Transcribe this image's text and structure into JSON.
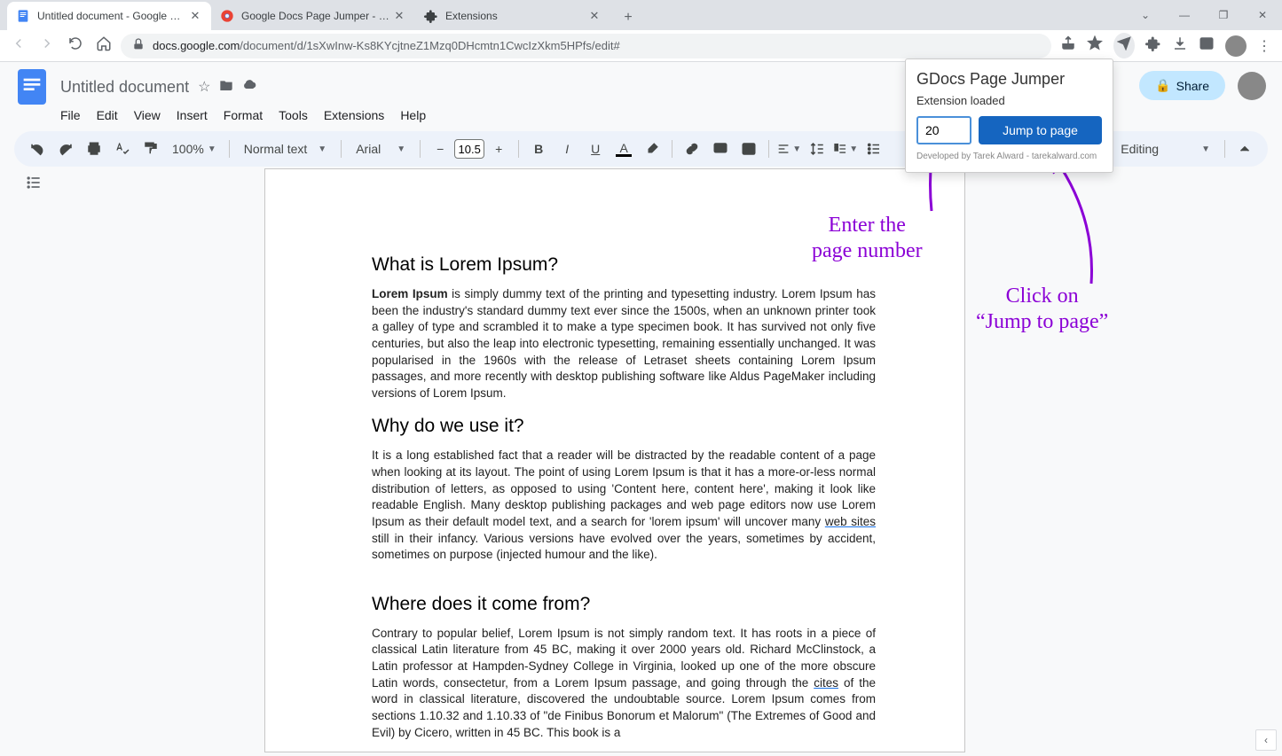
{
  "browser": {
    "tabs": [
      {
        "title": "Untitled document - Google Docs",
        "favicon": "docs"
      },
      {
        "title": "Google Docs Page Jumper - Chrome",
        "favicon": "chrome"
      },
      {
        "title": "Extensions",
        "favicon": "puzzle"
      }
    ],
    "url_domain": "docs.google.com",
    "url_path": "/document/d/1sXwInw-Ks8KYcjtneZ1Mzq0DHcmtn1CwcIzXkm5HPfs/edit#"
  },
  "docs": {
    "title": "Untitled document",
    "menu": [
      "File",
      "Edit",
      "View",
      "Insert",
      "Format",
      "Tools",
      "Extensions",
      "Help"
    ],
    "share": "Share",
    "zoom": "100%",
    "style": "Normal text",
    "font": "Arial",
    "font_size": "10.5",
    "mode": "Editing"
  },
  "doc_content": {
    "h1": "What is Lorem Ipsum?",
    "p1_lead": "Lorem Ipsum",
    "p1": " is simply dummy text of the printing and typesetting industry. Lorem Ipsum has been the industry's standard dummy text ever since the 1500s, when an unknown printer took a galley of type and scrambled it to make a type specimen book. It has survived not only five centuries, but also the leap into electronic typesetting, remaining essentially unchanged. It was popularised in the 1960s with the release of Letraset sheets containing Lorem Ipsum passages, and more recently with desktop publishing software like Aldus PageMaker including versions of Lorem Ipsum.",
    "h2": "Why do we use it?",
    "p2a": "It is a long established fact that a reader will be distracted by the readable content of a page when looking at its layout. The point of using Lorem Ipsum is that it has a more-or-less normal distribution of letters, as opposed to using 'Content here, content here', making it look like readable English. Many desktop publishing packages and web page editors now use Lorem Ipsum as their default model text, and a search for 'lorem ipsum' will uncover many ",
    "p2_link": "web sites",
    "p2b": " still in their infancy. Various versions have evolved over the years, sometimes by accident, sometimes on purpose (injected humour and the like).",
    "h3": "Where does it come from?",
    "p3a": "Contrary to popular belief, Lorem Ipsum is not simply random text. It has roots in a piece of classical Latin literature from 45 BC, making it over 2000 years old. Richard McClinstock, a Latin professor at Hampden-Sydney College in Virginia, looked up one of the more obscure Latin words, consectetur, from a Lorem Ipsum passage, and going through the ",
    "p3_link": "cites",
    "p3b": " of the word in classical literature, discovered the undoubtable source. Lorem Ipsum comes from sections 1.10.32 and 1.10.33 of \"de Finibus Bonorum et Malorum\" (The Extremes of Good and Evil) by Cicero, written in 45 BC. This book is a"
  },
  "popup": {
    "title": "GDocs Page Jumper",
    "subtitle": "Extension loaded",
    "input_value": "20",
    "button": "Jump to page",
    "credit": "Developed by Tarek Alward - tarekalward.com"
  },
  "annotations": {
    "a1_l1": "Enter the",
    "a1_l2": "page number",
    "a2_l1": "Click on",
    "a2_l2": "“Jump to page”"
  }
}
